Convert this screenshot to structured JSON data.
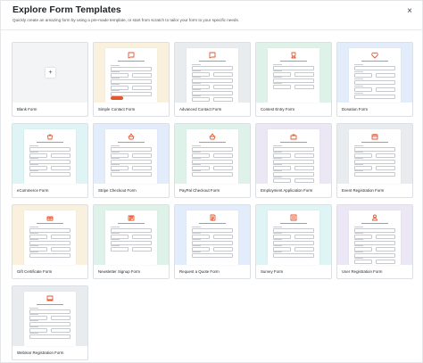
{
  "header": {
    "title": "Explore Form Templates",
    "subtitle": "Quickly create an amazing form by using a pre-made template, or start from scratch to tailor your form to your specific needs.",
    "close_icon": "×"
  },
  "colors": {
    "accent": "#e4572e",
    "blank_bg": "#f3f4f5",
    "beige": "#faf0de",
    "grey": "#e8ecef",
    "mint": "#dff2ea",
    "blue": "#e3ecfb",
    "cyan": "#dff4f4",
    "purple": "#ece7f5"
  },
  "templates": [
    {
      "label": "Blank Form",
      "theme": "blank_bg"
    },
    {
      "label": "Simple Contact Form",
      "theme": "beige"
    },
    {
      "label": "Advanced Contact Form",
      "theme": "grey"
    },
    {
      "label": "Contest Entry Form",
      "theme": "mint"
    },
    {
      "label": "Donation Form",
      "theme": "blue"
    },
    {
      "label": "eCommerce Form",
      "theme": "cyan"
    },
    {
      "label": "Stripe Checkout Form",
      "theme": "blue"
    },
    {
      "label": "PayPal Checkout Form",
      "theme": "mint"
    },
    {
      "label": "Employment Application Form",
      "theme": "purple"
    },
    {
      "label": "Event Registration Form",
      "theme": "grey"
    },
    {
      "label": "Gift Certificate Form",
      "theme": "beige"
    },
    {
      "label": "Newsletter Signup Form",
      "theme": "mint"
    },
    {
      "label": "Request a Quote Form",
      "theme": "blue"
    },
    {
      "label": "Survey Form",
      "theme": "cyan"
    },
    {
      "label": "User Registration Form",
      "theme": "purple"
    },
    {
      "label": "Webinar Registration Form",
      "theme": "grey"
    }
  ],
  "blank_plus": "+"
}
